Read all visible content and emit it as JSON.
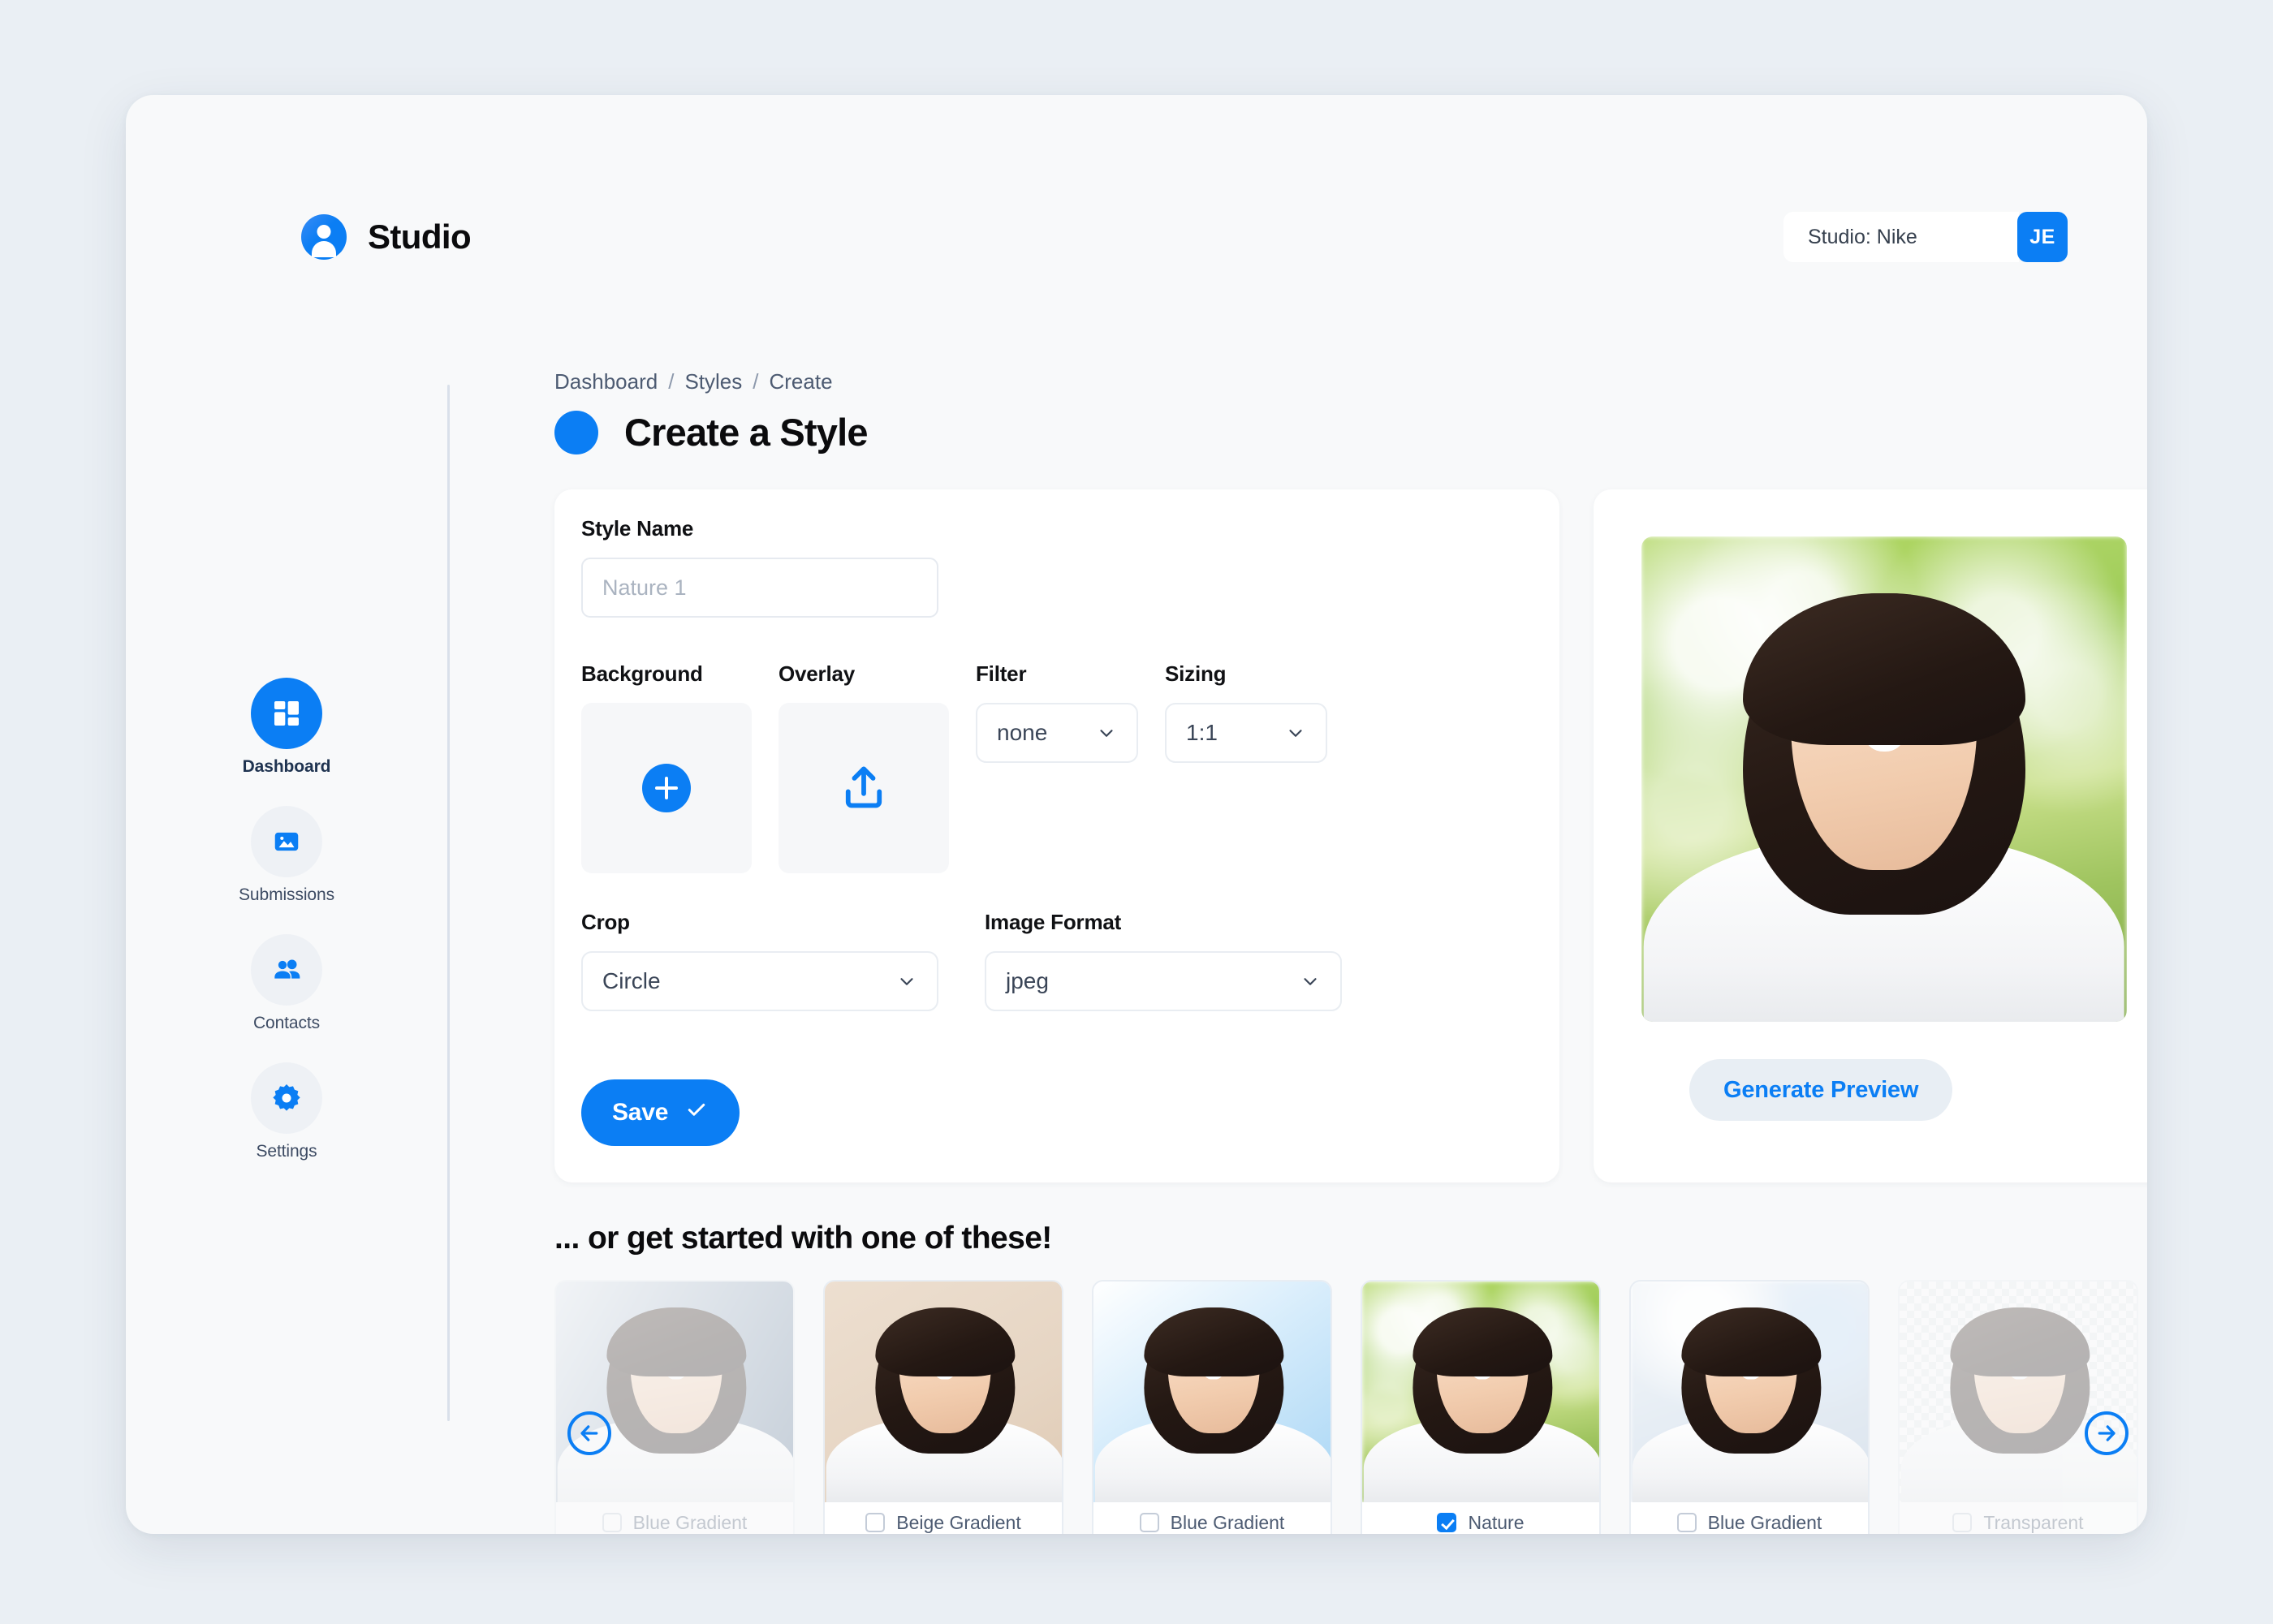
{
  "brand": {
    "name": "Studio",
    "logo_icon": "user-avatar-icon"
  },
  "header": {
    "studio_label": "Studio: Nike",
    "avatar_initials": "JE"
  },
  "sidebar": {
    "items": [
      {
        "label": "Dashboard",
        "icon": "grid-dashboard-icon",
        "active": true
      },
      {
        "label": "Submissions",
        "icon": "image-icon",
        "active": false
      },
      {
        "label": "Contacts",
        "icon": "people-icon",
        "active": false
      },
      {
        "label": "Settings",
        "icon": "gear-icon",
        "active": false
      }
    ]
  },
  "breadcrumb": {
    "items": [
      "Dashboard",
      "Styles",
      "Create"
    ],
    "separator": "/"
  },
  "page": {
    "title": "Create a Style"
  },
  "form": {
    "style_name": {
      "label": "Style Name",
      "value": "",
      "placeholder": "Nature 1"
    },
    "background": {
      "label": "Background",
      "action_icon": "plus-icon"
    },
    "overlay": {
      "label": "Overlay",
      "action_icon": "upload-icon"
    },
    "filter": {
      "label": "Filter",
      "value": "none"
    },
    "sizing": {
      "label": "Sizing",
      "value": "1:1"
    },
    "crop": {
      "label": "Crop",
      "value": "Circle"
    },
    "image_format": {
      "label": "Image Format",
      "value": "jpeg"
    },
    "save_label": "Save",
    "save_icon": "check-icon"
  },
  "preview": {
    "generate_label": "Generate Preview",
    "image_background": "nature"
  },
  "gallery": {
    "heading": "... or get started with one of these!",
    "prev_icon": "arrow-left-circle-icon",
    "next_icon": "arrow-right-circle-icon",
    "items": [
      {
        "label": "Blue Gradient",
        "checked": false,
        "bg": "bg-blue-grad",
        "dim": true
      },
      {
        "label": "Beige Gradient",
        "checked": false,
        "bg": "bg-beige",
        "dim": false
      },
      {
        "label": "Blue Gradient",
        "checked": false,
        "bg": "bg-blue-soft",
        "dim": false
      },
      {
        "label": "Nature",
        "checked": true,
        "bg": "bg-nature",
        "dim": false
      },
      {
        "label": "Blue Gradient",
        "checked": false,
        "bg": "bg-office",
        "dim": false
      },
      {
        "label": "Transparent",
        "checked": false,
        "bg": "bg-checker",
        "dim": true
      }
    ]
  },
  "colors": {
    "accent": "#0b7ef4",
    "page_bg": "#eaeff4",
    "window_bg": "#f8f9fa",
    "card_bg": "#ffffff",
    "text": "#0b0b0d",
    "muted_text": "#4d5b72"
  }
}
